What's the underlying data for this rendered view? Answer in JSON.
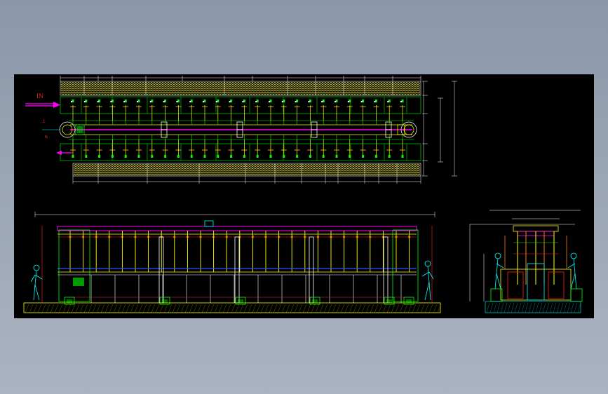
{
  "drawing": {
    "background": "#000000",
    "colors": {
      "yellow": "#ffff00",
      "green": "#00ff00",
      "magenta": "#ff00ff",
      "cyan": "#00ffff",
      "white": "#ffffff",
      "red": "#ff2020",
      "blue": "#3050ff",
      "orange": "#ff8000"
    },
    "plan_view": {
      "in_label": "IN",
      "in_arrow_icon": "arrow-right-icon",
      "out_arrow_icon": "arrow-left-icon",
      "side_marks": [
        "上",
        "N"
      ]
    },
    "views": [
      "plan-view",
      "front-elevation-view",
      "side-elevation-view"
    ]
  }
}
